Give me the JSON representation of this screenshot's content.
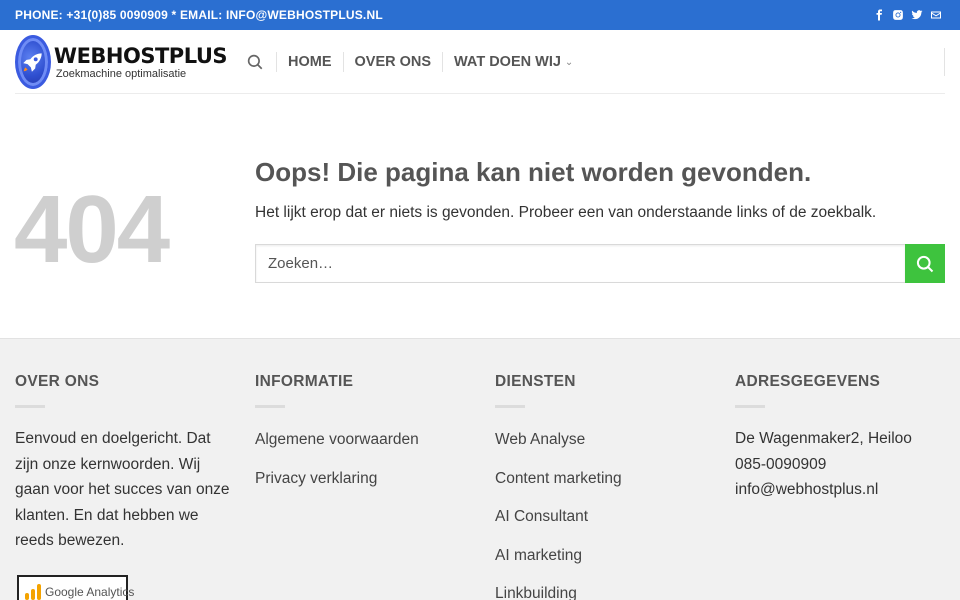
{
  "topbar": {
    "contact": "PHONE: +31(0)85 0090909 * EMAIL: INFO@WEBHOSTPLUS.NL",
    "social_icons": [
      "facebook-icon",
      "instagram-icon",
      "twitter-icon",
      "email-icon"
    ]
  },
  "header": {
    "logo_title": "WEBHOSTPLUS",
    "logo_subtitle": "Zoekmachine optimalisatie",
    "nav": {
      "home": "HOME",
      "over_ons": "OVER ONS",
      "wat_doen_wij": "WAT DOEN WIJ"
    }
  },
  "main": {
    "code": "404",
    "title": "Oops! Die pagina kan niet worden gevonden.",
    "message": "Het lijkt erop dat er niets is gevonden. Probeer een van onderstaande links of de zoekbalk.",
    "search_placeholder": "Zoeken…"
  },
  "footer": {
    "over_ons": {
      "heading": "OVER ONS",
      "text": "Eenvoud en doelgericht. Dat zijn onze kernwoorden. Wij gaan voor het succes van onze klanten. En dat hebben we reeds bewezen.",
      "badge": "Google Analytics"
    },
    "informatie": {
      "heading": "INFORMATIE",
      "links": [
        "Algemene voorwaarden",
        "Privacy verklaring"
      ]
    },
    "diensten": {
      "heading": "DIENSTEN",
      "links": [
        "Web Analyse",
        "Content marketing",
        "AI Consultant",
        "AI marketing",
        "Linkbuilding"
      ]
    },
    "adres": {
      "heading": "ADRESGEGEVENS",
      "street": "De Wagenmaker2, Heiloo",
      "phone": "085-0090909",
      "email": "info@webhostplus.nl"
    }
  },
  "colors": {
    "topbar": "#2b6fd1",
    "search_button": "#3ec33e",
    "footer_bg": "#f1f1f1"
  }
}
